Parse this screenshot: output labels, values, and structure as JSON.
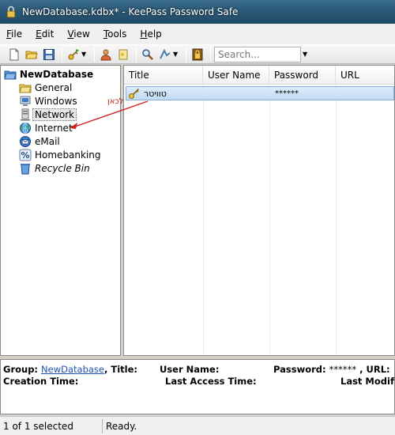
{
  "window": {
    "title": "NewDatabase.kdbx* - KeePass Password Safe"
  },
  "menu": [
    {
      "key": "F",
      "rest": "ile"
    },
    {
      "key": "E",
      "rest": "dit"
    },
    {
      "key": "V",
      "rest": "iew"
    },
    {
      "key": "T",
      "rest": "ools"
    },
    {
      "key": "H",
      "rest": "elp"
    }
  ],
  "toolbar": {
    "search_placeholder": "Search..."
  },
  "tree": {
    "root": "NewDatabase",
    "groups": [
      "General",
      "Windows",
      "Network",
      "Internet",
      "eMail",
      "Homebanking",
      "Recycle Bin"
    ]
  },
  "annotation": {
    "text": "גררו לכאן"
  },
  "list": {
    "columns": [
      "Title",
      "User Name",
      "Password",
      "URL"
    ],
    "entries": [
      {
        "title": "טוויטר",
        "user": "",
        "password": "******"
      }
    ]
  },
  "details": {
    "group_label": "Group:",
    "group_value": "NewDatabase",
    "title_label": ", Title:",
    "user_label": "User Name:",
    "password_label": "Password:",
    "password_value": "******",
    "url_label": ", URL:",
    "creation_label": "Creation Time:",
    "access_label": "Last Access Time:",
    "modif_label": "Last Modifica"
  },
  "status": {
    "selection": "1 of 1 selected",
    "state": "Ready."
  }
}
